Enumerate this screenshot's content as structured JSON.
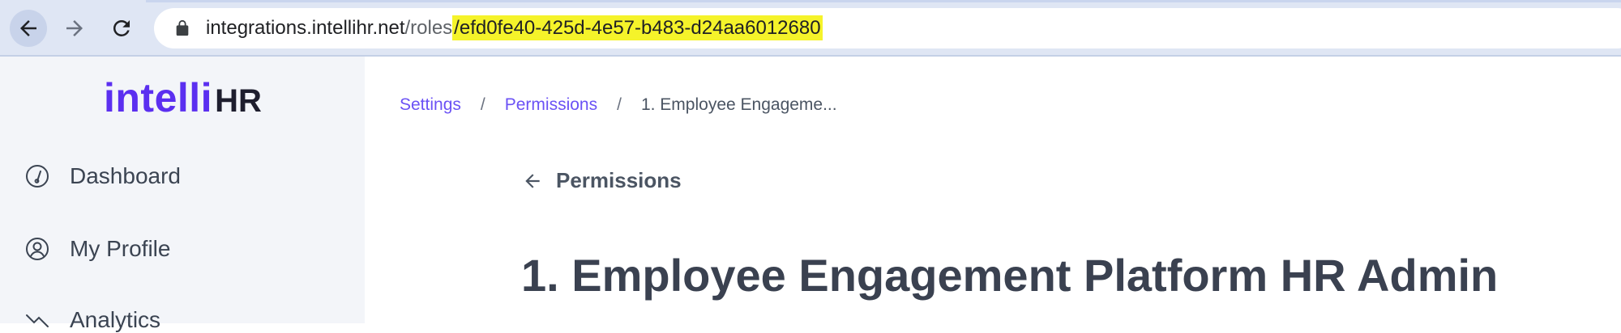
{
  "browser": {
    "url_domain": "integrations.intellihr.net",
    "url_path": "/roles",
    "url_highlight": "/efd0fe40-425d-4e57-b483-d24aa6012680"
  },
  "sidebar": {
    "logo_main": "intelli",
    "logo_suffix": "HR",
    "items": [
      {
        "label": "Dashboard",
        "icon": "dashboard-gauge-icon"
      },
      {
        "label": "My Profile",
        "icon": "user-circle-icon"
      },
      {
        "label": "Analytics",
        "icon": "chart-icon"
      }
    ]
  },
  "breadcrumb": {
    "items": [
      "Settings",
      "Permissions",
      "1. Employee Engageme..."
    ],
    "separator": "/"
  },
  "back_link": {
    "label": "Permissions"
  },
  "page": {
    "title": "1. Employee Engagement Platform HR Admin"
  },
  "colors": {
    "brand": "#5b2ff0",
    "link": "#6b52f5",
    "url_highlight": "#f5f32a",
    "sidebar_bg": "#f3f5f9",
    "chrome_bg": "#dfe6f4"
  }
}
